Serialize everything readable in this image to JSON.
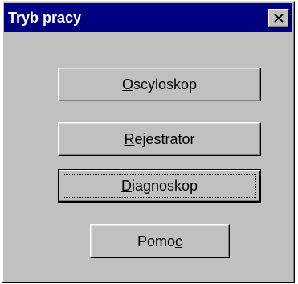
{
  "window": {
    "title": "Tryb pracy",
    "close_symbol": "✕"
  },
  "buttons": [
    {
      "accel": "O",
      "rest": "scyloskop",
      "label": "Oscyloskop"
    },
    {
      "accel": "R",
      "rest": "ejestrator",
      "label": "Rejestrator"
    },
    {
      "accel": "D",
      "rest": "iagnoskop",
      "label": "Diagnoskop",
      "focused": true
    },
    {
      "pre": "Pomo",
      "accel": "c",
      "label": "Pomoc"
    }
  ],
  "colors": {
    "face": "#c0c0c0",
    "titlebar": "#000080",
    "title_text": "#ffffff"
  }
}
